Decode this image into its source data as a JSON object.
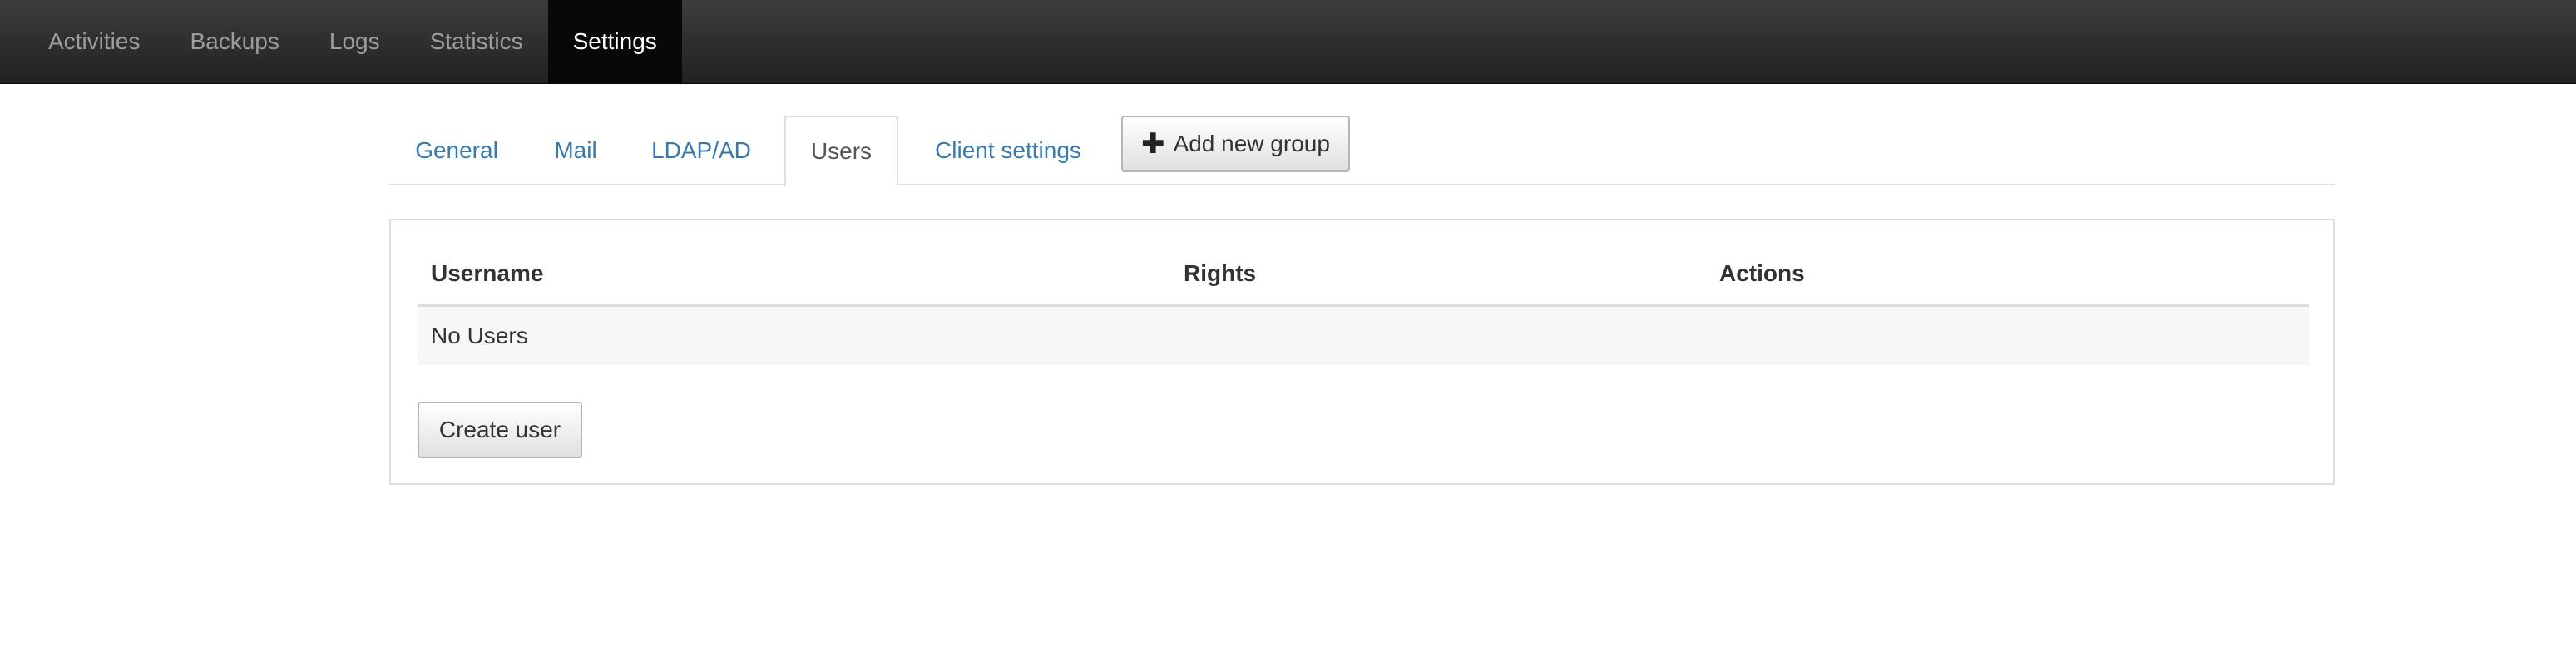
{
  "navbar": {
    "items": [
      {
        "label": "Activities"
      },
      {
        "label": "Backups"
      },
      {
        "label": "Logs"
      },
      {
        "label": "Statistics"
      },
      {
        "label": "Settings",
        "active": true
      }
    ]
  },
  "tabs": {
    "items": [
      {
        "label": "General"
      },
      {
        "label": "Mail"
      },
      {
        "label": "LDAP/AD"
      },
      {
        "label": "Users",
        "active": true
      },
      {
        "label": "Client settings"
      }
    ],
    "add_group_label": "Add new group",
    "add_group_icon": "plus-icon"
  },
  "users_table": {
    "columns": [
      "Username",
      "Rights",
      "Actions"
    ],
    "empty_message": "No Users"
  },
  "create_user_label": "Create user",
  "colors": {
    "link": "#337ab7",
    "navbar_bg": "#222222",
    "navbar_active_bg": "#080808",
    "navbar_text": "#9d9d9d"
  }
}
